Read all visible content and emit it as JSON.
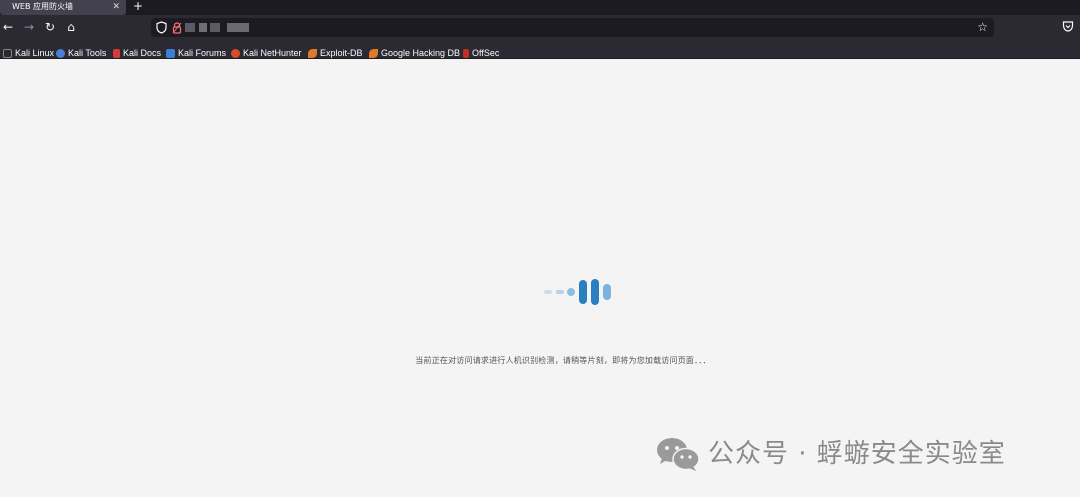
{
  "browser": {
    "tab": {
      "title": "WEB 应用防火墙",
      "close_glyph": "✕"
    },
    "new_tab_glyph": "+",
    "nav": {
      "back": "←",
      "forward": "→",
      "reload": "↻",
      "home": "⌂"
    },
    "url": {
      "star_glyph": "☆"
    },
    "bookmarks": [
      {
        "label": "Kali Linux",
        "icon": "kali-dragon-icon",
        "color": "#2a2a2a"
      },
      {
        "label": "Kali Tools",
        "icon": "kali-tools-icon",
        "color": "#4a7fd4"
      },
      {
        "label": "Kali Docs",
        "icon": "kali-docs-icon",
        "color": "#d63a3a"
      },
      {
        "label": "Kali Forums",
        "icon": "kali-forums-icon",
        "color": "#3a7fd4"
      },
      {
        "label": "Kali NetHunter",
        "icon": "kali-nethunter-icon",
        "color": "#d94a2a"
      },
      {
        "label": "Exploit-DB",
        "icon": "exploit-db-icon",
        "color": "#e07a2a"
      },
      {
        "label": "Google Hacking DB",
        "icon": "ghdb-icon",
        "color": "#e07a2a"
      },
      {
        "label": "OffSec",
        "icon": "offsec-icon",
        "color": "#c0302a"
      }
    ]
  },
  "page": {
    "loading_text": "当前正在对访问请求进行人机识别检测，请稍等片刻，即将为您加载访问页面．．．",
    "loader_color": "#2a7fc1"
  },
  "watermark": {
    "text": "公众号 · 蜉蝣安全实验室",
    "icon": "wechat-icon"
  }
}
